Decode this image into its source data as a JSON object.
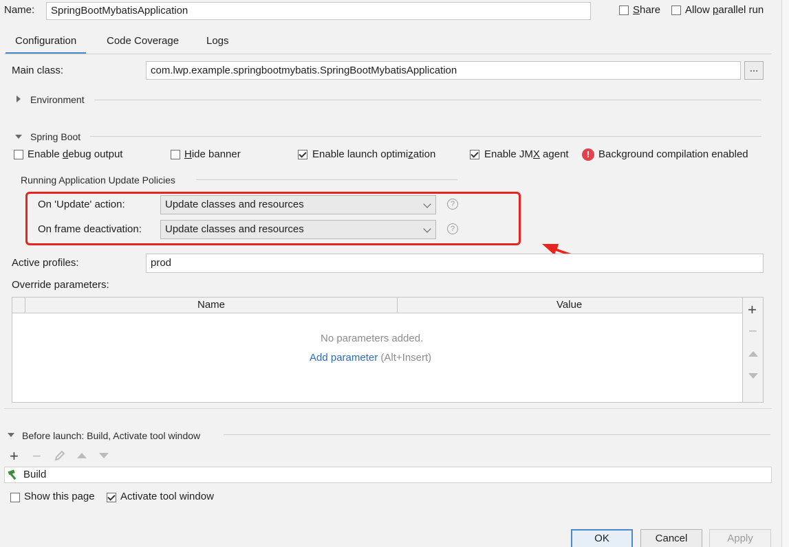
{
  "name_label": "Name:",
  "name_value": "SpringBootMybatisApplication",
  "share": {
    "label_pre": "",
    "label_u": "S",
    "label_post": "hare",
    "checked": false
  },
  "allow_parallel": {
    "label_pre": "Allow ",
    "label_u": "p",
    "label_post": "arallel run",
    "checked": false
  },
  "tabs": [
    {
      "label": "Configuration",
      "active": true
    },
    {
      "label": "Code Coverage",
      "active": false
    },
    {
      "label": "Logs",
      "active": false
    }
  ],
  "main_class": {
    "label": "Main class:",
    "value": "com.lwp.example.springbootmybatis.SpringBootMybatisApplication",
    "browse": "..."
  },
  "environment": {
    "title": "Environment"
  },
  "spring_boot": {
    "title": "Spring Boot",
    "debug": {
      "pre": "Enable ",
      "u": "d",
      "post": "ebug output",
      "checked": false
    },
    "hide_banner": {
      "pre": "",
      "u": "H",
      "post": "ide banner",
      "checked": false
    },
    "launch_opt": {
      "pre": "Enable launch optimi",
      "u": "z",
      "post": "ation",
      "checked": true
    },
    "jmx": {
      "pre": "Enable JM",
      "u": "X",
      "post": " agent",
      "checked": true
    },
    "bg_compile": "Background compilation enabled"
  },
  "update_policies": {
    "title": "Running Application Update Policies",
    "on_update": {
      "label": "On 'Update' action:",
      "value": "Update classes and resources"
    },
    "on_frame": {
      "label": "On frame deactivation:",
      "value": "Update classes and resources"
    }
  },
  "active_profiles": {
    "label": "Active profiles:",
    "value": "prod"
  },
  "override": {
    "label": "Override parameters:",
    "columns": [
      "Name",
      "Value"
    ],
    "empty": "No parameters added.",
    "add_link": "Add parameter",
    "add_shortcut": "(Alt+Insert)"
  },
  "before_launch": {
    "title": "Before launch: Build, Activate tool window",
    "tasks": [
      "Build"
    ],
    "show_page": {
      "label": "Show this page",
      "checked": false
    },
    "activate": {
      "label": "Activate tool window",
      "checked": true
    }
  },
  "buttons": {
    "ok": "OK",
    "cancel": "Cancel",
    "apply": "Apply"
  },
  "colors": {
    "accent": "#4a88c7",
    "link": "#2a6ebb",
    "highlight": "#e8241c",
    "error": "#e0424f"
  }
}
